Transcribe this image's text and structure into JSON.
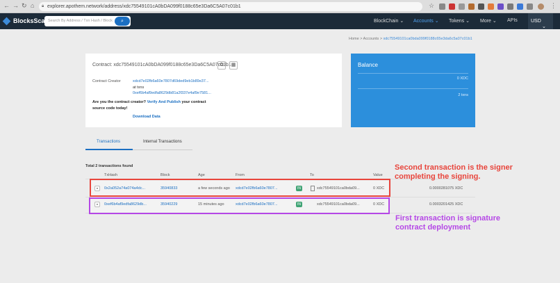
{
  "browser": {
    "url": "explorer.apothem.network/address/xdc75549101cA0bDA099f0188c65e3Da6C5A07c01b1"
  },
  "navbar": {
    "logo": "BlocksScan",
    "search_placeholder": "Search By Address / Txn Hash / Block",
    "menu": [
      "BlockChain ⌄",
      "Accounts ⌄",
      "Tokens ⌄",
      "More ⌄",
      "APIs"
    ],
    "currency": "USD"
  },
  "breadcrumb": {
    "home": "Home",
    "sep": ">",
    "accounts": "Accounts",
    "address": "xdc75549101ca0bda099f0188c65e3da6c5a07c01b1"
  },
  "contract": {
    "title": "Contract: xdc75549101cA0bDA099f0188c65e3Da6C5A07c01b1",
    "creator_label": "Contract Creator",
    "creator_address": "xdcd7e02fb6a60e7807d69ded9eb1b89e37...",
    "at_txns": "at txns",
    "creation_txn": "0xef6b4af9edfa8629db81a2f337e4af9e7581...",
    "question_prefix": "Are you the contract creator?",
    "question_link": "Verify And Publish",
    "question_suffix": "your contract source code today!",
    "download": "Download Data"
  },
  "balance": {
    "title": "Balance",
    "amount": "0 XDC",
    "txns": "2 txns"
  },
  "tabs": [
    {
      "label": "Transactions",
      "active": true
    },
    {
      "label": "Internal Transactions",
      "active": false
    }
  ],
  "table": {
    "total": "Total 2 transactions found",
    "headers": [
      "TxHash",
      "Block",
      "Age",
      "From",
      "To",
      "Value"
    ],
    "rows": [
      {
        "hash": "0x2a052a74a074a4dc...",
        "block": "35940833",
        "age": "a few seconds ago",
        "from": "xdcd7e02fb6a60e7807...",
        "direction": "IN",
        "to": "xdc75549101ca0bda09...",
        "value": "0 XDC",
        "fee": "0.0000281075 XDC"
      },
      {
        "hash": "0xef6b4af9edfa8629db...",
        "block": "35940229",
        "age": "15 minutes ago",
        "from": "xdcd7e02fb6a60e7807...",
        "direction": "IN",
        "to": "xdc75549101ca0bda09...",
        "value": "0 XDC",
        "fee": "0.0003201425 XDC"
      }
    ]
  },
  "annotations": {
    "red_line1": "Second transaction is the signer",
    "red_line2": "completing the signing.",
    "purple_line1": "First transaction is signature",
    "purple_line2": "contract deployment",
    "red_color": "#e8453c",
    "purple_color": "#b547e6"
  }
}
